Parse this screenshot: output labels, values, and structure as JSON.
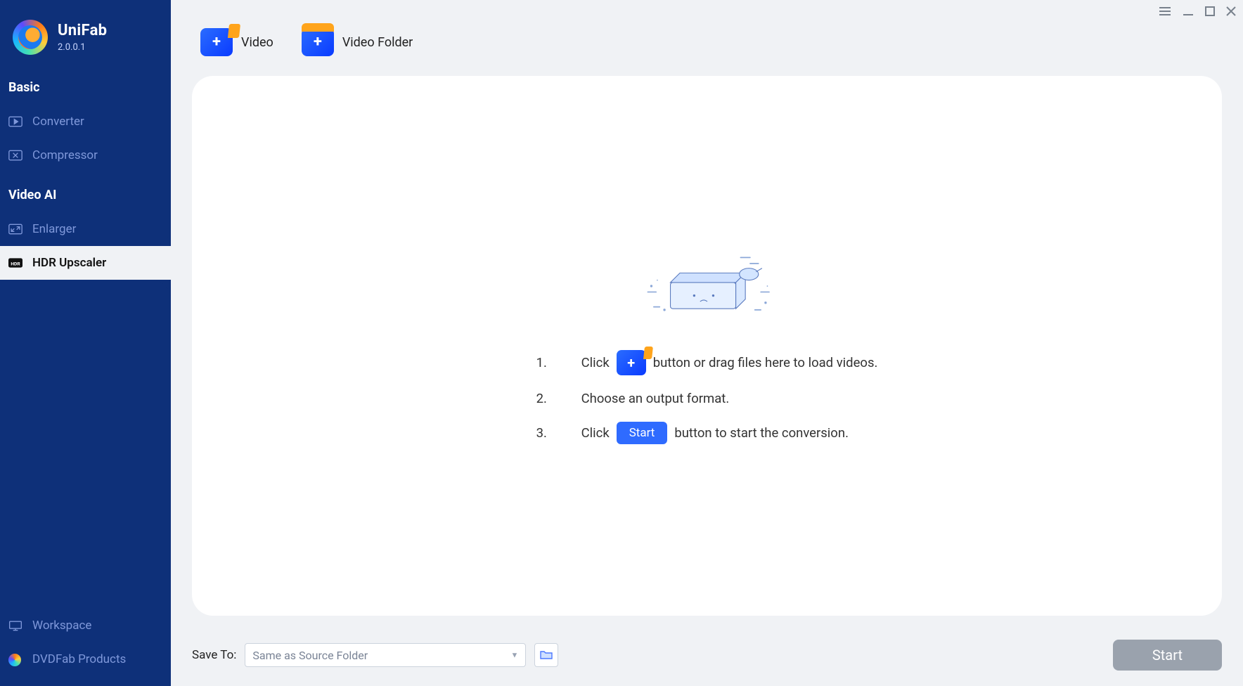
{
  "app": {
    "name": "UniFab",
    "version": "2.0.0.1"
  },
  "sidebar": {
    "section_basic": "Basic",
    "section_videoai": "Video AI",
    "items": {
      "converter": {
        "label": "Converter"
      },
      "compressor": {
        "label": "Compressor"
      },
      "enlarger": {
        "label": "Enlarger"
      },
      "hdr": {
        "label": "HDR Upscaler"
      },
      "workspace": {
        "label": "Workspace"
      },
      "dvdfab": {
        "label": "DVDFab Products"
      }
    }
  },
  "toolbar": {
    "video_label": "Video",
    "video_folder_label": "Video Folder"
  },
  "instructions": {
    "step1_num": "1.",
    "step1_a": "Click",
    "step1_b": "button or drag files here to load videos.",
    "step2_num": "2.",
    "step2": "Choose an output format.",
    "step3_num": "3.",
    "step3_a": "Click",
    "step3_start": "Start",
    "step3_b": "button to start the conversion."
  },
  "bottom": {
    "save_label": "Save To:",
    "save_value": "Same as Source Folder",
    "start_label": "Start"
  }
}
